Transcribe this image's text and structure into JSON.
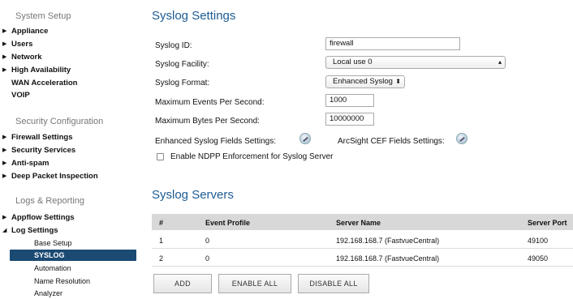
{
  "sidebar": {
    "section_system": "System Setup",
    "system_items": [
      "Appliance",
      "Users",
      "Network",
      "High Availability",
      "WAN Acceleration",
      "VOIP"
    ],
    "section_security": "Security Configuration",
    "security_items": [
      "Firewall Settings",
      "Security Services",
      "Anti-spam",
      "Deep Packet Inspection"
    ],
    "section_logs": "Logs & Reporting",
    "logs_items": [
      "Appflow Settings",
      "Log Settings"
    ],
    "log_subitems": [
      "Base Setup",
      "SYSLOG",
      "Automation",
      "Name Resolution",
      "Analyzer"
    ]
  },
  "syslog_settings": {
    "title": "Syslog Settings",
    "syslog_id_label": "Syslog ID:",
    "syslog_id_value": "firewall",
    "facility_label": "Syslog Facility:",
    "facility_value": "Local use 0",
    "format_label": "Syslog Format:",
    "format_value": "Enhanced Syslog",
    "max_events_label": "Maximum Events Per Second:",
    "max_events_value": "1000",
    "max_bytes_label": "Maximum Bytes Per Second:",
    "max_bytes_value": "10000000",
    "enhanced_fields_label": "Enhanced Syslog Fields Settings:",
    "arcsight_fields_label": "ArcSight CEF Fields Settings:",
    "ndpp_label": "Enable NDPP Enforcement for Syslog Server"
  },
  "syslog_servers": {
    "title": "Syslog Servers",
    "columns": [
      "#",
      "Event Profile",
      "Server Name",
      "Server Port"
    ],
    "rows": [
      [
        "1",
        "0",
        "192.168.168.7 (FastvueCentral)",
        "49100"
      ],
      [
        "2",
        "0",
        "192.168.168.7 (FastvueCentral)",
        "49050"
      ]
    ],
    "add_label": "ADD",
    "enable_all_label": "ENABLE ALL",
    "disable_all_label": "DISABLE ALL"
  },
  "colors": {
    "accent": "#1d5c93",
    "active_nav": "#1b4a73",
    "table_header": "#d8d8d8"
  }
}
